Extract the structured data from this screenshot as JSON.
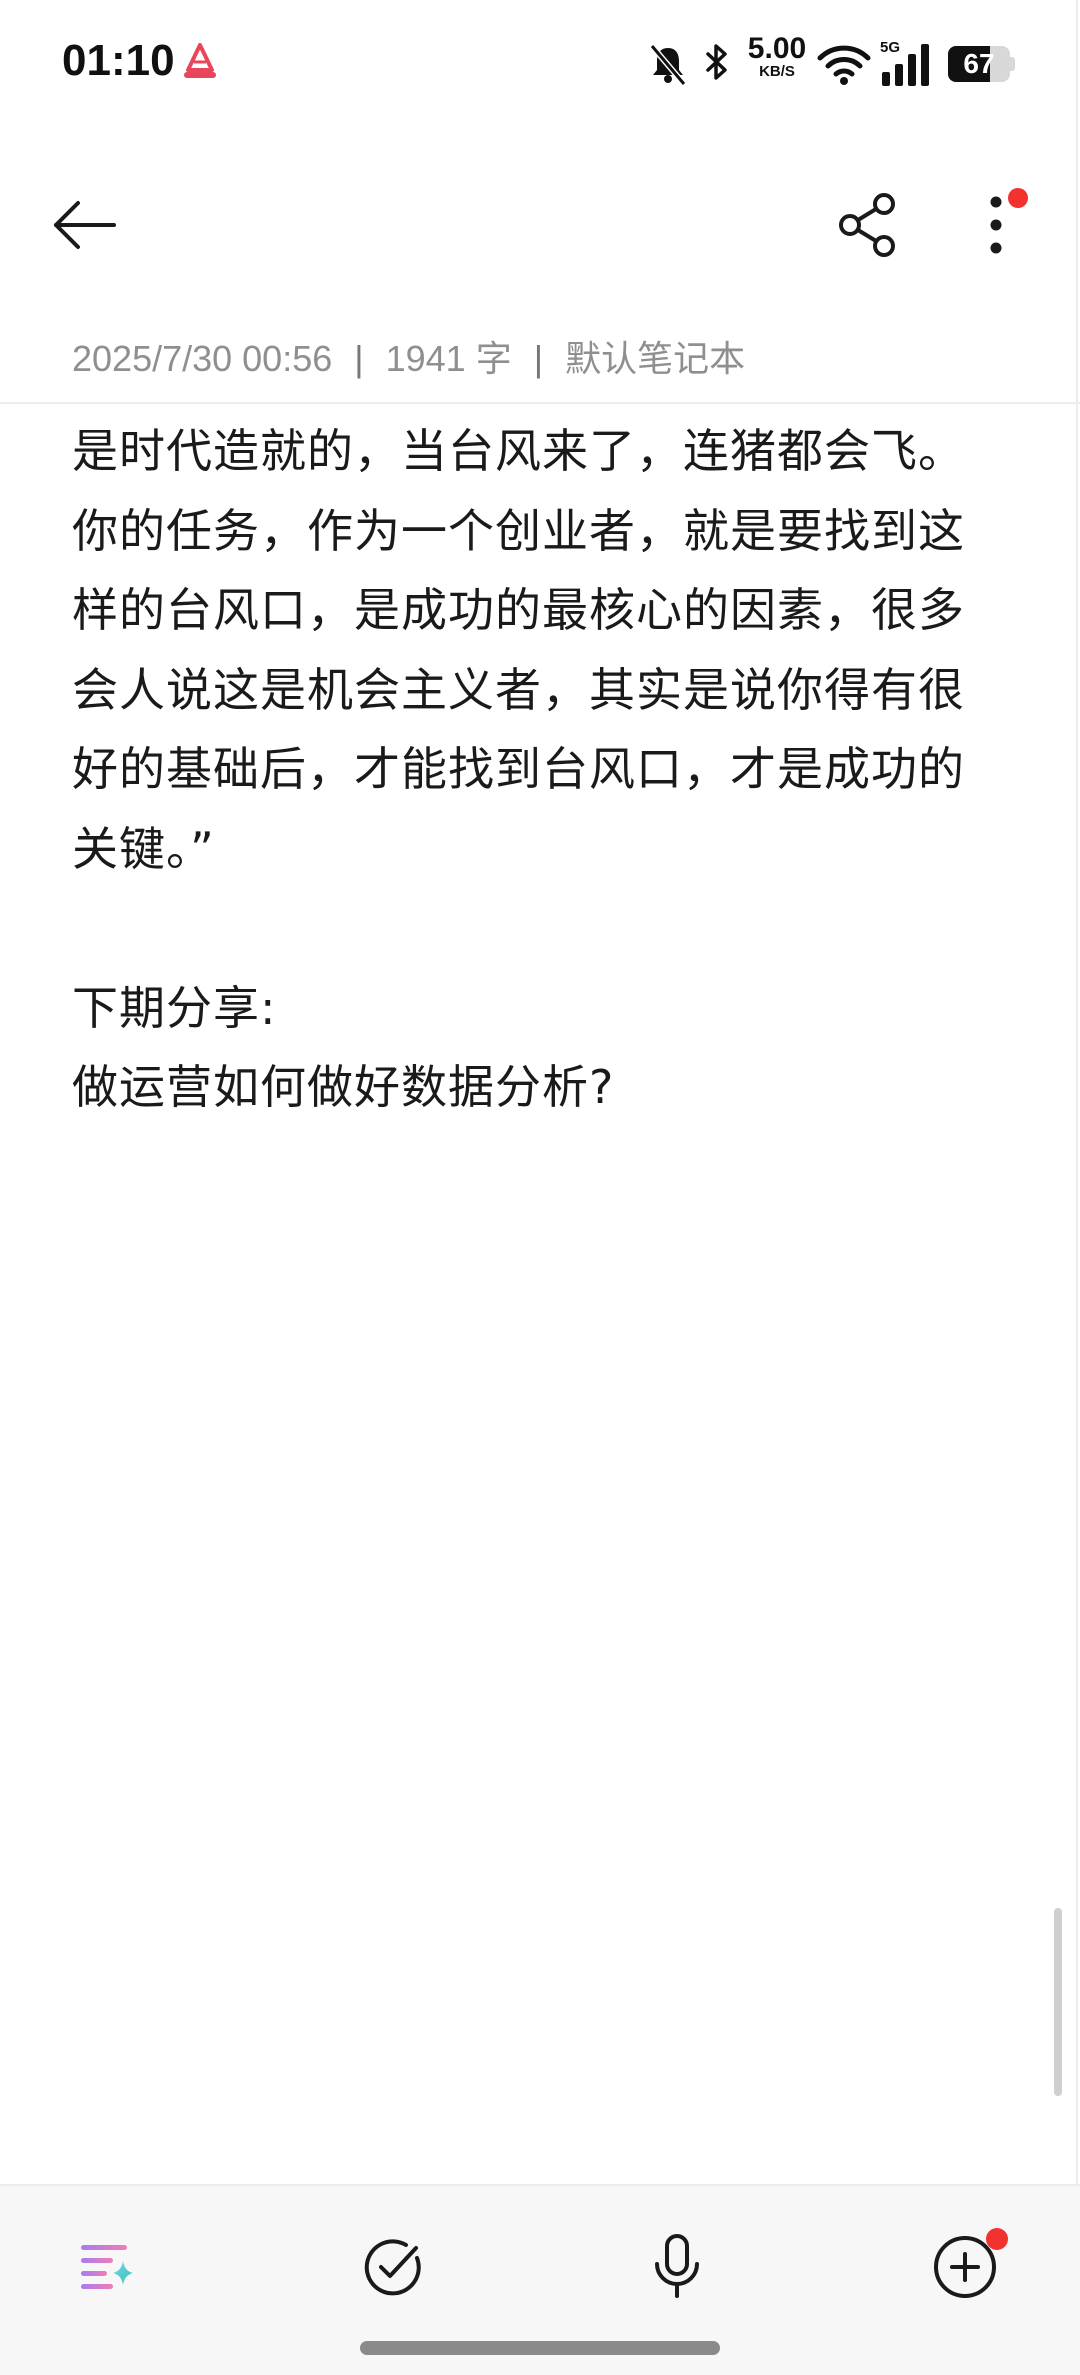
{
  "status_bar": {
    "time": "01:10",
    "net_speed_value": "5.00",
    "net_speed_unit": "KB/S",
    "network_type": "5G",
    "battery_level": "67",
    "battery_fraction": 0.67,
    "icons": [
      "app-logo-icon",
      "mute-bell-icon",
      "bluetooth-icon",
      "wifi-icon",
      "cellular-signal-icon",
      "battery-icon"
    ]
  },
  "toolbar": {
    "icons": [
      "back-arrow-icon",
      "share-icon",
      "more-vertical-icon"
    ],
    "more_has_badge": true
  },
  "note": {
    "date": "2025/7/30 00:56",
    "separator": "|",
    "word_count": "1941 字",
    "notebook": "默认笔记本",
    "paragraph1_lines": [
      "是时代造就的，当台风来了，连猪都会飞。",
      "你的任务，作为一个创业者，就是要找到这",
      "样的台风口，是成功的最核心的因素，很多",
      "会人说这是机会主义者，其实是说你得有很",
      "好的基础后，才能找到台风口，才是成功的",
      "关键。”"
    ],
    "paragraph2_lines": [
      "下期分享:",
      "做运营如何做好数据分析?"
    ]
  },
  "bottom_bar": {
    "icons": [
      "ai-format-icon",
      "todo-check-icon",
      "microphone-icon",
      "add-circle-icon"
    ],
    "add_has_badge": true
  },
  "colors": {
    "accent_red": "#f2322f",
    "text_primary": "#1a1a1a",
    "text_meta": "#8f8f8f",
    "bottom_bar_bg": "#f7f7f7"
  }
}
